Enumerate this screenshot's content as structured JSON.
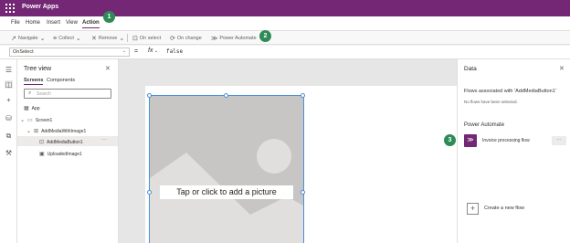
{
  "app": {
    "title": "Power Apps"
  },
  "menu": {
    "items": [
      "File",
      "Home",
      "Insert",
      "View",
      "Action"
    ],
    "active": "Action"
  },
  "toolbar": {
    "navigate": "Navigate",
    "collect": "Collect",
    "remove": "Remove",
    "on_select": "On select",
    "on_change": "On change",
    "power_automate": "Power Automate"
  },
  "formula_bar": {
    "property": "OnSelect",
    "equals": "=",
    "fx": "fx",
    "formula": "false"
  },
  "tree_view": {
    "title": "Tree view",
    "tabs": [
      "Screens",
      "Components"
    ],
    "search_placeholder": "Search",
    "items": [
      {
        "label": "App",
        "icon": "app-icon"
      },
      {
        "label": "Screen1",
        "icon": "screen-icon"
      },
      {
        "label": "AddMediaWithImage1",
        "icon": "group-icon"
      },
      {
        "label": "AddMediaButton1",
        "icon": "media-button-icon"
      },
      {
        "label": "UploadedImage1",
        "icon": "image-icon"
      }
    ],
    "more": "···"
  },
  "canvas": {
    "image_placeholder": "Tap or click to add a picture"
  },
  "data_panel": {
    "title": "Data",
    "flows_associated": "Flows associated with 'AddMediaButton1'",
    "no_flows": "No flows have been selected.",
    "power_automate_heading": "Power Automate",
    "flow_name": "Invoice processing flow",
    "flow_more": "···",
    "create_flow": "Create a new flow"
  },
  "callouts": [
    "1",
    "2",
    "3"
  ],
  "colors": {
    "brand": "#742774",
    "callout": "#2e8b57",
    "selection": "#4a90d9"
  }
}
